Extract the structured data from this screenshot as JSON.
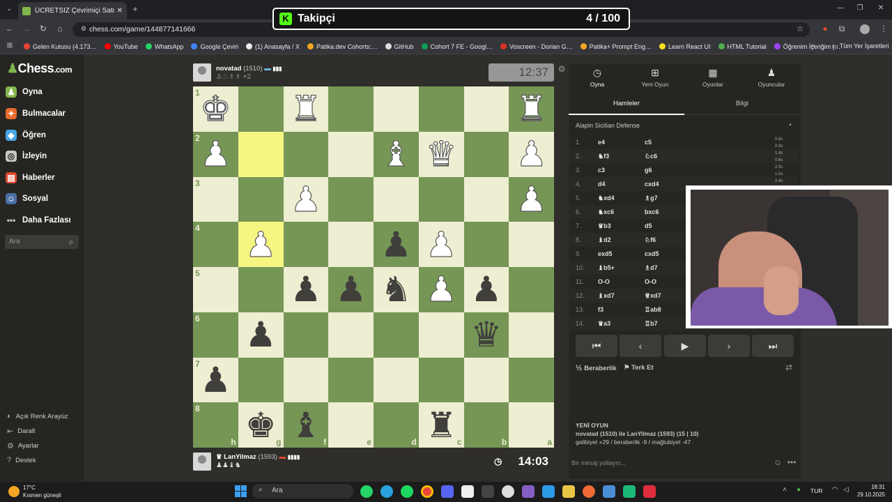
{
  "browser": {
    "tab_title": "ÜCRETSİZ Çevrimiçi Satranç Oy…",
    "url": "chess.com/game/144877141666",
    "bookmarks": [
      "Gelen Kutusu (4.173…",
      "YouTube",
      "WhatsApp",
      "Google Çeviri",
      "(1) Anasayfa / X",
      "Patika.dev Cohorts:…",
      "GitHub",
      "Cohort 7 FE - Googl…",
      "Voscreen - Dorian G…",
      "Patika+ Prompt Eng…",
      "Learn React UI",
      "HTML Tutorial",
      "Öğrenim İçeriğim |…"
    ],
    "all_bookmarks": "Tüm Yer İşaretleri",
    "colors": {
      "tab_bar": "#1f2023",
      "toolbar": "#35363a"
    }
  },
  "overlay": {
    "label": "Takipçi",
    "count": "4 / 100",
    "icon": "kick-logo-icon",
    "colors": {
      "accent": "#53fc18"
    }
  },
  "sidebar": {
    "logo_main": "Chess",
    "logo_suffix": ".com",
    "items": [
      {
        "label": "Oyna",
        "icon": "play-icon",
        "color": "#81b64c"
      },
      {
        "label": "Bulmacalar",
        "icon": "puzzle-icon",
        "color": "#e66c2c"
      },
      {
        "label": "Öğren",
        "icon": "learn-icon",
        "color": "#45a7e6"
      },
      {
        "label": "İzleyin",
        "icon": "watch-icon",
        "color": "#c9c8c5"
      },
      {
        "label": "Haberler",
        "icon": "news-icon",
        "color": "#e0492d"
      },
      {
        "label": "Sosyal",
        "icon": "social-icon",
        "color": "#4a6fa5"
      },
      {
        "label": "Daha Fazlası",
        "icon": "more-icon",
        "color": "#c9c8c5"
      }
    ],
    "search_placeholder": "Ara",
    "bottom": [
      "Açık Renk Arayüz",
      "Daralt",
      "Ayarlar",
      "Destek"
    ]
  },
  "game": {
    "top_player": {
      "name": "novatad",
      "rating": "(1510)",
      "material": "+2"
    },
    "top_clock": "12:37",
    "bottom_player": {
      "name": "LanYilmaz",
      "rating": "(1593)"
    },
    "bottom_clock": "14:03",
    "board": {
      "ranks": [
        "1",
        "2",
        "3",
        "4",
        "5",
        "6",
        "7",
        "8"
      ],
      "files": [
        "h",
        "g",
        "f",
        "e",
        "d",
        "c",
        "b",
        "a"
      ],
      "rows": [
        [
          "wK",
          "",
          "wR",
          "",
          "",
          "",
          "",
          "wR"
        ],
        [
          "wP",
          "",
          "",
          "",
          "wB",
          "wQ",
          "",
          "wP"
        ],
        [
          "",
          "",
          "wP",
          "",
          "",
          "",
          "",
          "wP"
        ],
        [
          "",
          "wP",
          "",
          "",
          "bP",
          "wP",
          "",
          ""
        ],
        [
          "",
          "",
          "bP",
          "bP",
          "bN",
          "wP",
          "bP",
          ""
        ],
        [
          "",
          "bP",
          "",
          "",
          "",
          "",
          "bQ",
          ""
        ],
        [
          "bP",
          "",
          "",
          "",
          "",
          "",
          "",
          ""
        ],
        [
          "",
          "bK",
          "bB",
          "",
          "",
          "bR",
          "",
          ""
        ]
      ],
      "highlight": [
        [
          1,
          1
        ],
        [
          3,
          1
        ]
      ],
      "colors": {
        "light": "#eeeed2",
        "dark": "#769656",
        "highlight": "#f5f682"
      }
    }
  },
  "panel": {
    "tabs": [
      {
        "label": "Oyna",
        "icon": "clock-icon"
      },
      {
        "label": "Yeni Oyun",
        "icon": "plus-icon"
      },
      {
        "label": "Oyunlar",
        "icon": "board-icon"
      },
      {
        "label": "Oyuncular",
        "icon": "players-icon"
      }
    ],
    "subtabs": [
      "Hamleler",
      "Bilgi"
    ],
    "opening": "Alapin Sicilian Defense",
    "moves": [
      {
        "n": "1.",
        "w": "e4",
        "b": "c5"
      },
      {
        "n": "2.",
        "w": "♞f3",
        "b": "♘c6"
      },
      {
        "n": "3.",
        "w": "c3",
        "b": "g6"
      },
      {
        "n": "4.",
        "w": "d4",
        "b": "cxd4"
      },
      {
        "n": "5.",
        "w": "♞xd4",
        "b": "♗g7"
      },
      {
        "n": "6.",
        "w": "♞xc6",
        "b": "bxc6"
      },
      {
        "n": "7.",
        "w": "♛b3",
        "b": "d5"
      },
      {
        "n": "8.",
        "w": "♝d2",
        "b": "♘f6"
      },
      {
        "n": "9.",
        "w": "exd5",
        "b": "cxd5"
      },
      {
        "n": "10.",
        "w": "♝b5+",
        "b": "♗d7"
      },
      {
        "n": "11.",
        "w": "O-O",
        "b": "O-O"
      },
      {
        "n": "12.",
        "w": "♝xd7",
        "b": "♕xd7"
      },
      {
        "n": "13.",
        "w": "f3",
        "b": "♖ab8"
      },
      {
        "n": "14.",
        "w": "♛a3",
        "b": "♖b7"
      }
    ],
    "times": [
      "0.8s",
      "0.9s",
      "1.4s",
      "0.6s",
      "2.9s",
      "1.0s",
      "2.4s"
    ],
    "draw": "Beraberlik",
    "resign": "Terk Et",
    "new_game_title": "YENİ OYUN",
    "new_game_line": "novatad (1510) ile LanYilmaz (1593) (15 | 10)",
    "new_game_stats": "galibiyet +29 / beraberlik -9 / mağlubiyet -47",
    "chat_placeholder": "Bir mesaj yollayın..."
  },
  "taskbar": {
    "weather_temp": "17°C",
    "weather_text": "Kısmen güneşli",
    "search": "Ara",
    "lang": "TUR",
    "time": "18:31",
    "date": "29.10.2025"
  }
}
